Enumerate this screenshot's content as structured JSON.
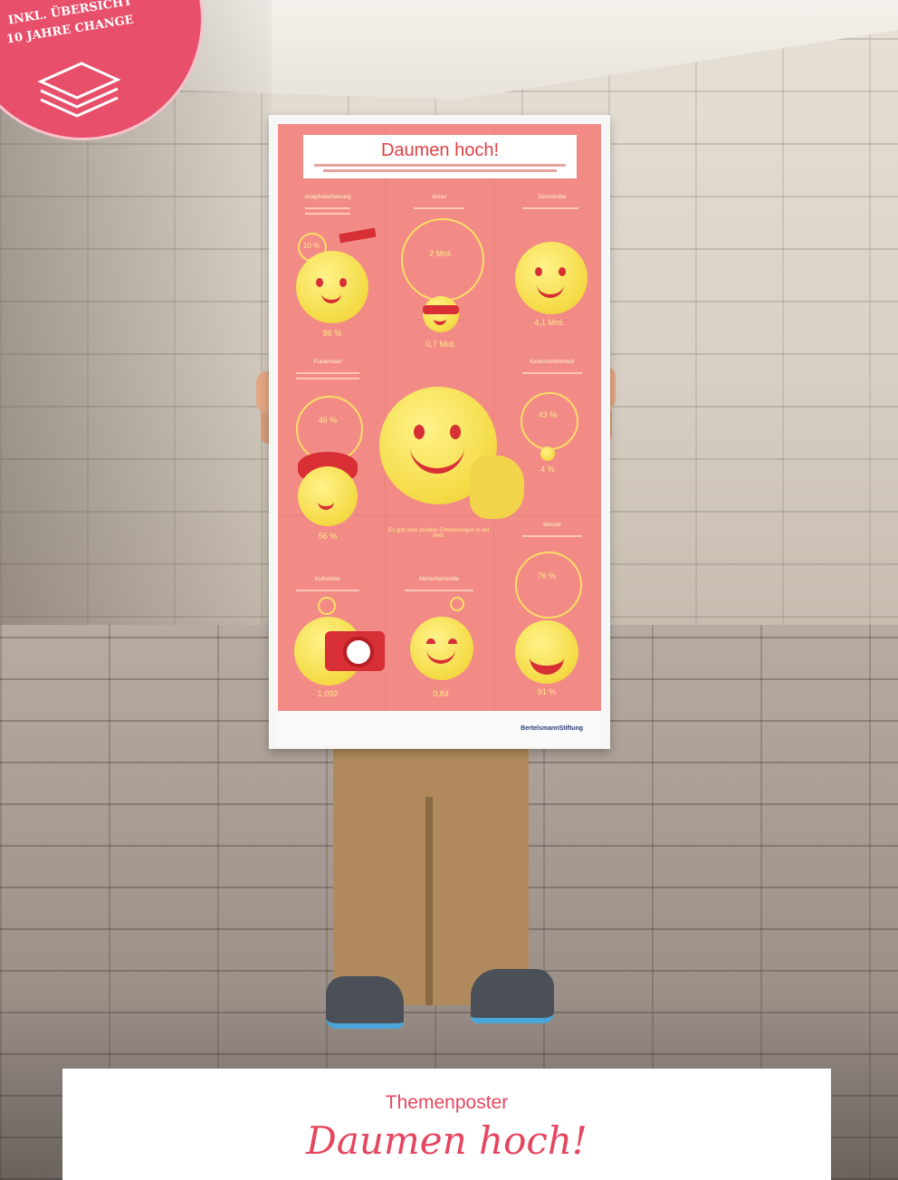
{
  "badge": {
    "line1": "INKL. ÜBERSICHT",
    "line2": "10 JAHRE CHANGE",
    "icon": "stacked-papers-icon",
    "color": "#e84f6b"
  },
  "poster": {
    "title": "Daumen hoch!",
    "brand": "BertelsmannStiftung",
    "background_color": "#f28b86",
    "accent_color": "#ffdd66",
    "sections": [
      {
        "heading": "Analphabetisierung",
        "inner_value": "10 %",
        "value": "86 %"
      },
      {
        "heading": "Armut",
        "inner_value": "2 Mrd.",
        "value": "0,7 Mrd."
      },
      {
        "heading": "Demokratie",
        "inner_value": "",
        "value": "4,1 Mrd."
      },
      {
        "heading": "Frauenwahl",
        "inner_value": "46 %",
        "value": "56 %"
      },
      {
        "heading": "Kindersterblichkeit",
        "inner_value": "43 %",
        "value": "4 %"
      },
      {
        "heading": "Wasser",
        "inner_value": "76 %",
        "value": "91 %"
      },
      {
        "heading": "Kulturerbe",
        "inner_value": "",
        "value": "1.092"
      },
      {
        "heading": "Menschenrechte",
        "inner_value": "",
        "value": "0,84"
      }
    ],
    "center_text": "Es gibt viele positive Entwicklungen in der Welt."
  },
  "caption": {
    "subtitle": "Themenposter",
    "title": "Daumen hoch!"
  }
}
